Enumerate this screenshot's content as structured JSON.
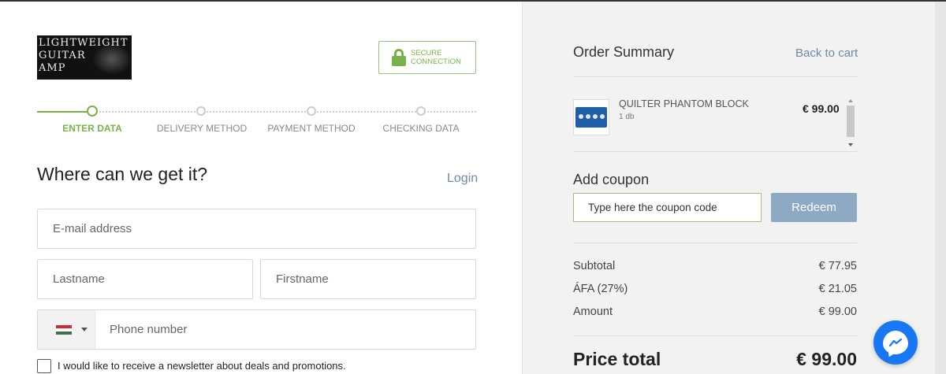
{
  "logo": {
    "text": "LIGHTWEIGHT\nGUITAR\nAMP"
  },
  "secure": {
    "label_line1": "SECURE",
    "label_line2": "CONNECTION",
    "icon": "lock-icon",
    "color": "#7ab24a"
  },
  "steps": [
    {
      "label": "ENTER DATA",
      "active": true
    },
    {
      "label": "DELIVERY METHOD",
      "active": false
    },
    {
      "label": "PAYMENT METHOD",
      "active": false
    },
    {
      "label": "CHECKING DATA",
      "active": false
    }
  ],
  "form": {
    "heading": "Where can we get it?",
    "login_label": "Login",
    "email_placeholder": "E-mail address",
    "lastname_placeholder": "Lastname",
    "firstname_placeholder": "Firstname",
    "phone_placeholder": "Phone number",
    "phone_country_flag": "hungary-flag",
    "newsletter_label": "I would like to receive a newsletter about deals and promotions."
  },
  "summary": {
    "title": "Order Summary",
    "back_label": "Back to cart",
    "product": {
      "name": "QUILTER PHANTOM BLOCK",
      "qty": "1 db",
      "price": "€ 99.00"
    },
    "coupon_title": "Add coupon",
    "coupon_value": "Type here the coupon code",
    "redeem_label": "Redeem",
    "rows": [
      {
        "label": "Subtotal",
        "value": "€ 77.95"
      },
      {
        "label": "ÁFA (27%)",
        "value": "€ 21.05"
      },
      {
        "label": "Amount",
        "value": "€ 99.00"
      }
    ],
    "total_label": "Price total",
    "total_value": "€ 99.00"
  },
  "colors": {
    "accent_green": "#7ab24a",
    "link_blue": "#6e8aa6",
    "button_blue": "#8da9c4",
    "messenger_blue": "#1877f2"
  },
  "chat": {
    "icon": "messenger-icon"
  }
}
